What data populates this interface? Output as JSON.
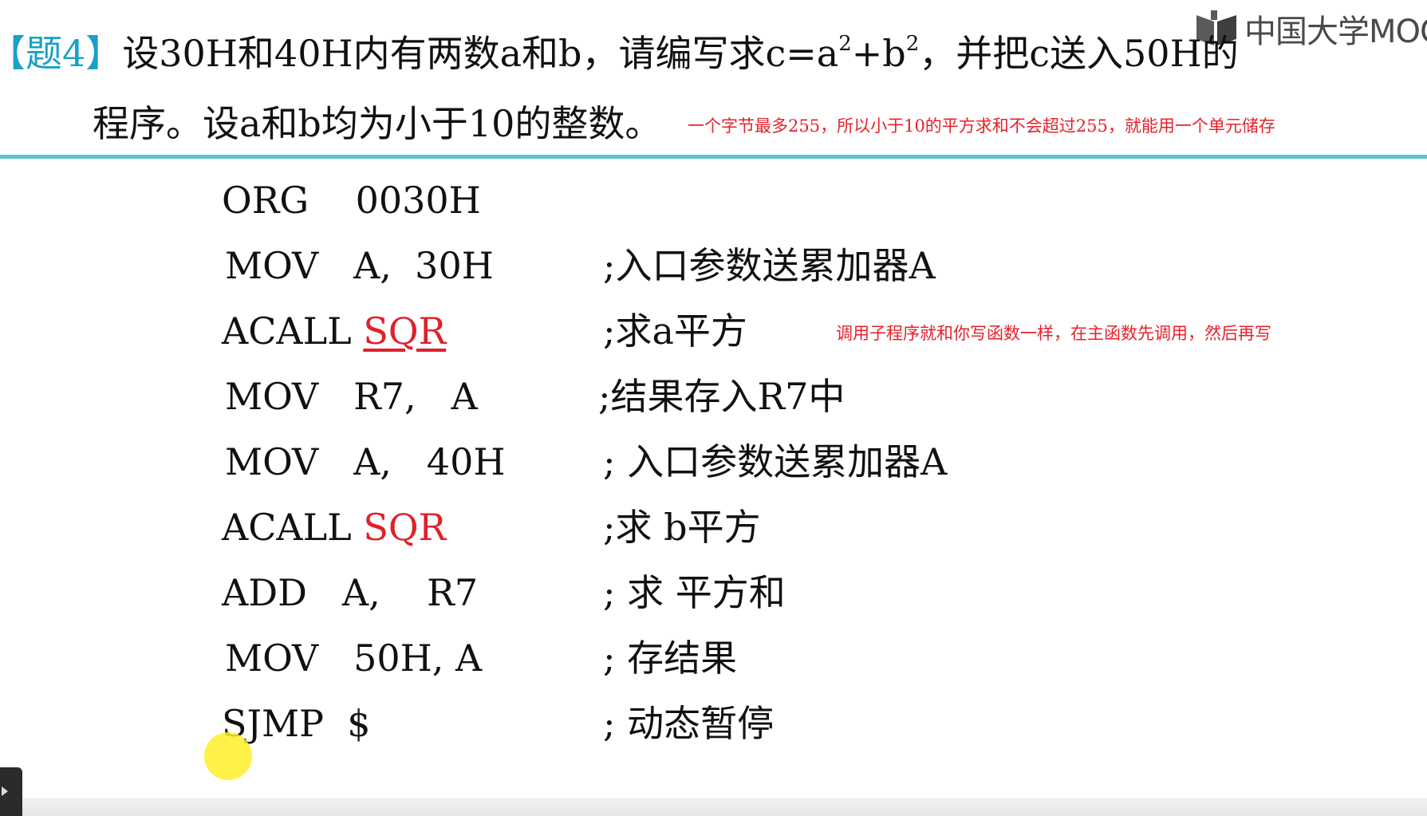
{
  "header": {
    "logo_text": "中国大学MOOC",
    "problem_tag": "【题4】",
    "problem_line1_a": "设30H和40H内有两数a和b，请编写求c=a",
    "problem_line1_sup1": "2",
    "problem_line1_b": "+b",
    "problem_line1_sup2": "2",
    "problem_line1_c": "，并把c送入50H的",
    "problem_line2": "程序。设a和b均为小于10的整数。"
  },
  "notes": {
    "byte_note": "一个字节最多255，所以小于10的平方求和不会超过255，就能用一个单元储存",
    "call_note": "调用子程序就和你写函数一样，在主函数先调用，然后再写"
  },
  "code": [
    {
      "instr": "ORG    0030H",
      "comment": ""
    },
    {
      "instr": "MOV   A,  30H",
      "comment": ";入口参数送累加器A"
    },
    {
      "instr_prefix": "ACALL ",
      "sub": "SQR",
      "comment": ";求a平方"
    },
    {
      "instr": "MOV   R7,   A",
      "comment": ";结果存入R7中"
    },
    {
      "instr": "MOV   A,   40H",
      "comment": "; 入口参数送累加器A"
    },
    {
      "instr_prefix": "ACALL ",
      "sub": "SQR",
      "comment": ";求 b平方"
    },
    {
      "instr": "ADD   A,    R7",
      "comment": "; 求 平方和"
    },
    {
      "instr": "MOV   50H, A",
      "comment": "; 存结果"
    },
    {
      "instr": "SJMP  $",
      "comment": "; 动态暂停"
    }
  ],
  "colors": {
    "tag": "#1aa0c8",
    "divider": "#5cc3cf",
    "annotation": "#e8202a"
  }
}
